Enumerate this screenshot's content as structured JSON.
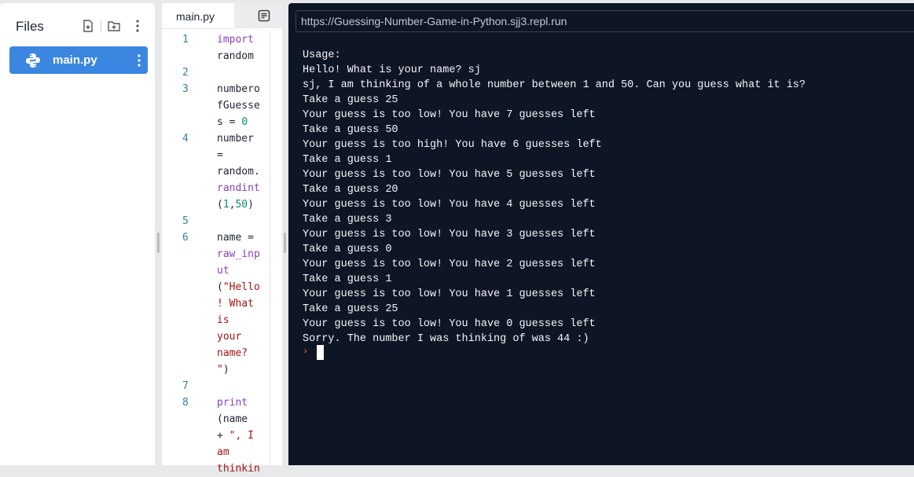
{
  "files_panel": {
    "title": "Files",
    "icons": [
      "new-file-icon",
      "new-folder-icon",
      "more-vertical-icon"
    ],
    "items": [
      {
        "label": "main.py",
        "icon": "python-icon",
        "selected": true
      }
    ]
  },
  "editor": {
    "tab_label": "main.py",
    "tab_strip_icon": "document-icon",
    "lines": [
      {
        "n": "1",
        "parts": [
          {
            "t": "import",
            "c": "kw"
          }
        ]
      },
      {
        "n": "",
        "parts": [
          {
            "t": "random",
            "c": "plain"
          }
        ]
      },
      {
        "n": "2",
        "parts": []
      },
      {
        "n": "3",
        "parts": [
          {
            "t": "numbero",
            "c": "plain"
          }
        ]
      },
      {
        "n": "",
        "parts": [
          {
            "t": "fGuesse",
            "c": "plain"
          }
        ]
      },
      {
        "n": "",
        "parts": [
          {
            "t": "s = ",
            "c": "plain"
          },
          {
            "t": "0",
            "c": "num"
          }
        ]
      },
      {
        "n": "4",
        "parts": [
          {
            "t": "number",
            "c": "plain"
          }
        ]
      },
      {
        "n": "",
        "parts": [
          {
            "t": "=",
            "c": "plain"
          }
        ]
      },
      {
        "n": "",
        "parts": [
          {
            "t": "random.",
            "c": "plain"
          }
        ]
      },
      {
        "n": "",
        "parts": [
          {
            "t": "randint",
            "c": "kw"
          }
        ]
      },
      {
        "n": "",
        "parts": [
          {
            "t": "(",
            "c": "plain"
          },
          {
            "t": "1",
            "c": "num"
          },
          {
            "t": ",",
            "c": "plain"
          },
          {
            "t": "50",
            "c": "num"
          },
          {
            "t": ")",
            "c": "plain"
          }
        ]
      },
      {
        "n": "5",
        "parts": []
      },
      {
        "n": "6",
        "parts": [
          {
            "t": "name =",
            "c": "plain"
          }
        ]
      },
      {
        "n": "",
        "parts": [
          {
            "t": "raw_inp",
            "c": "kw"
          }
        ]
      },
      {
        "n": "",
        "parts": [
          {
            "t": "ut",
            "c": "kw"
          }
        ]
      },
      {
        "n": "",
        "parts": [
          {
            "t": "(",
            "c": "plain"
          },
          {
            "t": "\"Hello",
            "c": "str"
          }
        ]
      },
      {
        "n": "",
        "parts": [
          {
            "t": "! What",
            "c": "str"
          }
        ]
      },
      {
        "n": "",
        "parts": [
          {
            "t": "is",
            "c": "str"
          }
        ]
      },
      {
        "n": "",
        "parts": [
          {
            "t": "your",
            "c": "str"
          }
        ]
      },
      {
        "n": "",
        "parts": [
          {
            "t": "name?",
            "c": "str"
          }
        ]
      },
      {
        "n": "",
        "parts": [
          {
            "t": "\"",
            "c": "str"
          },
          {
            "t": ")",
            "c": "plain"
          }
        ]
      },
      {
        "n": "7",
        "parts": []
      },
      {
        "n": "8",
        "parts": [
          {
            "t": "print",
            "c": "kw"
          }
        ]
      },
      {
        "n": "",
        "parts": [
          {
            "t": "(name",
            "c": "plain"
          }
        ]
      },
      {
        "n": "",
        "parts": [
          {
            "t": "+ ",
            "c": "plain"
          },
          {
            "t": "\", I",
            "c": "str"
          }
        ]
      },
      {
        "n": "",
        "parts": [
          {
            "t": "am",
            "c": "str"
          }
        ]
      },
      {
        "n": "",
        "parts": [
          {
            "t": "thinkin",
            "c": "str"
          }
        ]
      }
    ]
  },
  "console": {
    "url": "https://Guessing-Number-Game-in-Python.sjj3.repl.run",
    "output_lines": [
      "Usage:",
      "Hello! What is your name? sj",
      "sj, I am thinking of a whole number between 1 and 50. Can you guess what it is?",
      "Take a guess 25",
      "Your guess is too low! You have 7 guesses left",
      "Take a guess 50",
      "Your guess is too high! You have 6 guesses left",
      "Take a guess 1",
      "Your guess is too low! You have 5 guesses left",
      "Take a guess 20",
      "Your guess is too low! You have 4 guesses left",
      "Take a guess 3",
      "Your guess is too low! You have 3 guesses left",
      "Take a guess 0",
      "Your guess is too low! You have 2 guesses left",
      "Take a guess 1",
      "Your guess is too low! You have 1 guesses left",
      "Take a guess 25",
      "Your guess is too low! You have 0 guesses left",
      "Sorry. The number I was thinking of was 44 :)"
    ],
    "prompt_symbol": "›"
  }
}
